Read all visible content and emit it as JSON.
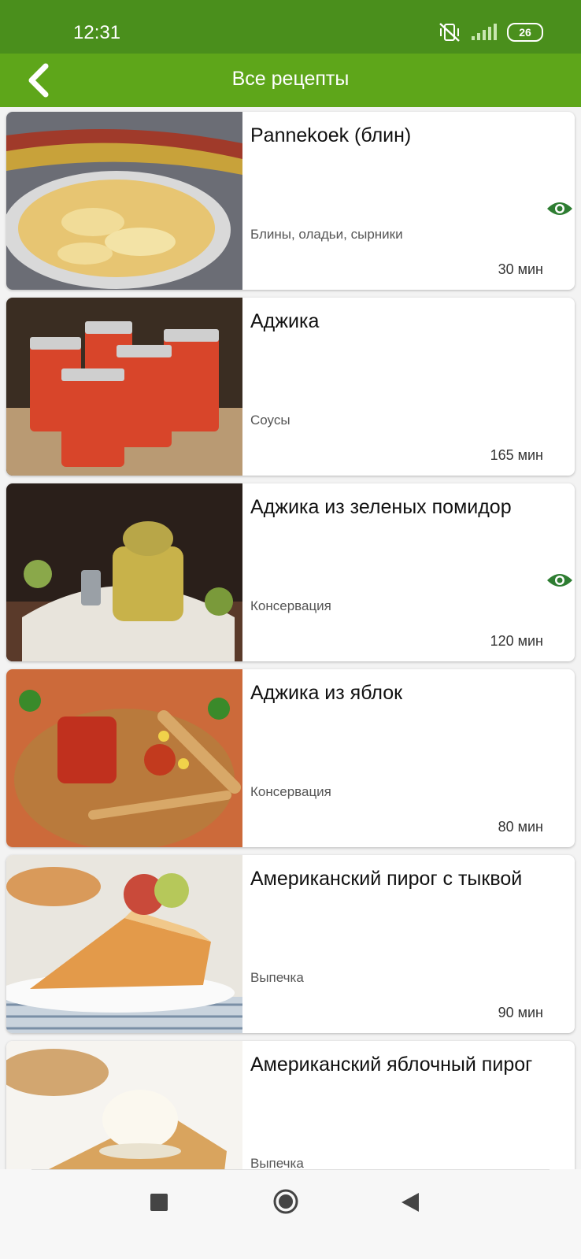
{
  "status_bar": {
    "time": "12:31",
    "battery": "26",
    "icons": [
      "mute-vibrate-icon",
      "signal-icon",
      "battery-icon"
    ]
  },
  "app_bar": {
    "title": "Все рецепты",
    "back_icon": "chevron-left-icon"
  },
  "recipes": [
    {
      "title": "Pannekoek (блин)",
      "category": "Блины, оладьи, сырники",
      "duration": "30 мин",
      "viewed": true
    },
    {
      "title": "Аджика",
      "category": "Соусы",
      "duration": "165 мин",
      "viewed": false
    },
    {
      "title": "Аджика из зеленых помидор",
      "category": "Консервация",
      "duration": "120 мин",
      "viewed": true
    },
    {
      "title": "Аджика из яблок",
      "category": "Консервация",
      "duration": "80 мин",
      "viewed": false
    },
    {
      "title": "Американский пирог с тыквой",
      "category": "Выпечка",
      "duration": "90 мин",
      "viewed": false
    },
    {
      "title": "Американский яблочный пирог",
      "category": "Выпечка",
      "duration": "",
      "viewed": false
    }
  ],
  "nav_bar": {
    "buttons": [
      "recents-square-icon",
      "home-circle-icon",
      "back-triangle-icon"
    ]
  },
  "colors": {
    "status_bar": "#4a8f1c",
    "app_bar": "#5ea61a",
    "eye_icon": "#2e7d32"
  }
}
